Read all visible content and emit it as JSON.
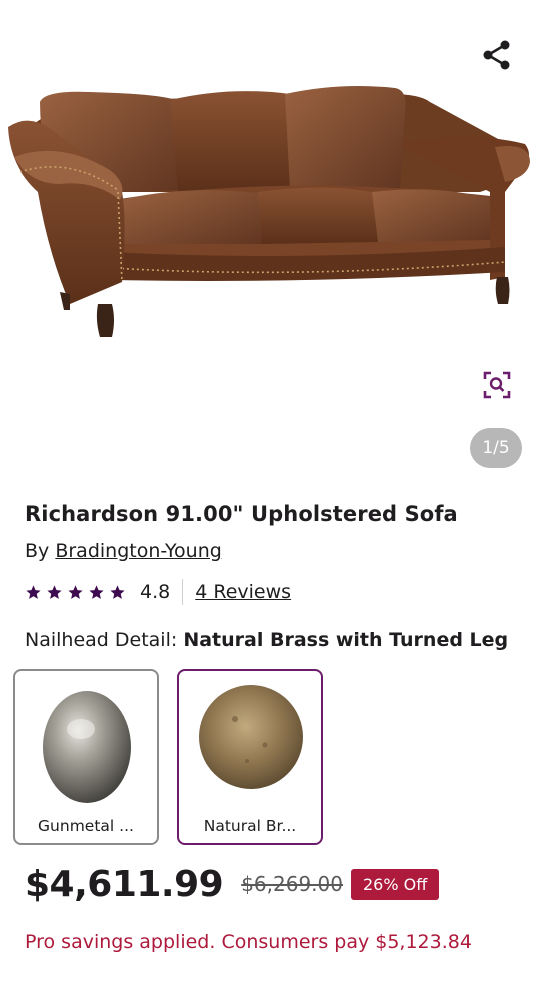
{
  "gallery": {
    "image_alt": "Brown leather three-seat sofa with nailhead trim and turned legs",
    "pager_text": "1/5",
    "share_icon": "share-icon",
    "zoom_icon": "visual-search-icon"
  },
  "product": {
    "title": "Richardson 91.00\" Upholstered Sofa",
    "by_prefix": "By",
    "brand": "Bradington-Young",
    "rating": "4.8",
    "stars_filled": 5,
    "reviews_label": "4 Reviews"
  },
  "option": {
    "name": "Nailhead Detail:",
    "selected_value": "Natural Brass with Turned Leg",
    "swatches": [
      {
        "label": "Gunmetal ...",
        "selected": false,
        "color": "#8d8a83"
      },
      {
        "label": "Natural Br...",
        "selected": true,
        "color": "#8f7650"
      }
    ]
  },
  "pricing": {
    "price": "$4,611.99",
    "original_price": "$6,269.00",
    "discount_badge": "26% Off",
    "pro_message": "Pro savings applied. Consumers pay $5,123.84"
  },
  "colors": {
    "accent_purple": "#6b1c6a",
    "sale_red": "#ad1a3c",
    "star_purple": "#3d0b4e"
  }
}
